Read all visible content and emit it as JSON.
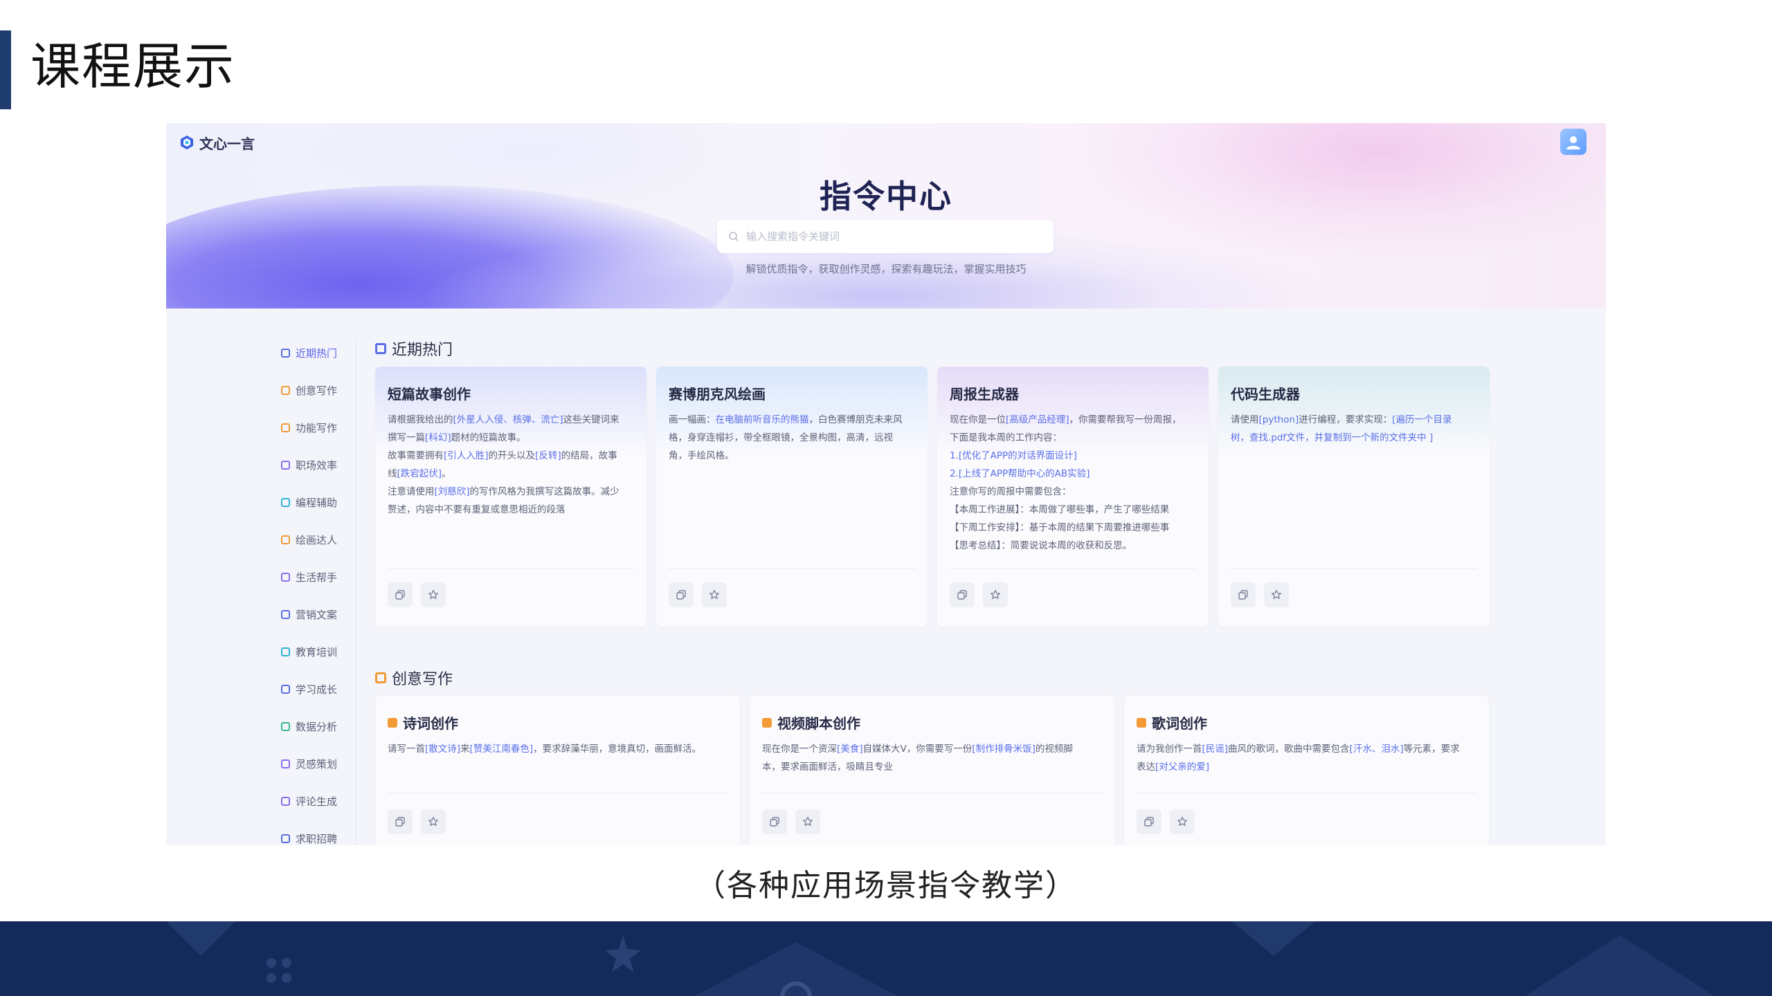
{
  "slide": {
    "title": "课程展示",
    "caption": "（各种应用场景指令教学）"
  },
  "app": {
    "logo_text": "文心一言",
    "hero_title": "指令中心",
    "search_placeholder": "输入搜索指令关键词",
    "hero_subtitle": "解锁优质指令，获取创作灵感，探索有趣玩法，掌握实用技巧"
  },
  "sidebar": {
    "items": [
      {
        "label": "近期热门",
        "color": "blue",
        "active": true
      },
      {
        "label": "创意写作",
        "color": "orange"
      },
      {
        "label": "功能写作",
        "color": "orange"
      },
      {
        "label": "职场效率",
        "color": "purple"
      },
      {
        "label": "编程辅助",
        "color": "cyan"
      },
      {
        "label": "绘画达人",
        "color": "orange"
      },
      {
        "label": "生活帮手",
        "color": "purple"
      },
      {
        "label": "营销文案",
        "color": "blue"
      },
      {
        "label": "教育培训",
        "color": "cyan"
      },
      {
        "label": "学习成长",
        "color": "blue"
      },
      {
        "label": "数据分析",
        "color": "green"
      },
      {
        "label": "灵感策划",
        "color": "purple"
      },
      {
        "label": "评论生成",
        "color": "purple"
      },
      {
        "label": "求职招聘",
        "color": "blue"
      }
    ]
  },
  "sections": {
    "hot": {
      "title": "近期热门",
      "cards": [
        {
          "title": "短篇故事创作",
          "lines": [
            [
              {
                "t": "请根据我给出的"
              },
              {
                "t": "[外星人入侵、核弹、流亡]",
                "h": true
              },
              {
                "t": "这些关键词来"
              }
            ],
            [
              {
                "t": "撰写一篇"
              },
              {
                "t": "[科幻]",
                "h": true
              },
              {
                "t": "题材的短篇故事。"
              }
            ],
            [
              {
                "t": "故事需要拥有"
              },
              {
                "t": "[引人入胜]",
                "h": true
              },
              {
                "t": "的开头以及"
              },
              {
                "t": "[反转]",
                "h": true
              },
              {
                "t": "的结局，故事"
              }
            ],
            [
              {
                "t": "线"
              },
              {
                "t": "[跌宕起伏]",
                "h": true
              },
              {
                "t": "。"
              }
            ],
            [
              {
                "t": "注意请使用"
              },
              {
                "t": "[刘慈欣]",
                "h": true
              },
              {
                "t": "的写作风格为我撰写这篇故事。减少"
              }
            ],
            [
              {
                "t": "赘述，内容中不要有重复或意思相近的段落"
              }
            ]
          ]
        },
        {
          "title": "赛博朋克风绘画",
          "lines": [
            [
              {
                "t": "画一幅画："
              },
              {
                "t": "在电脑前听音乐的熊猫",
                "h": true
              },
              {
                "t": "，白色赛博朋克未来风"
              }
            ],
            [
              {
                "t": "格，身穿连帽衫，带全框眼镜，全景构图，高清，远视"
              }
            ],
            [
              {
                "t": "角，手绘风格。"
              }
            ]
          ]
        },
        {
          "title": "周报生成器",
          "lines": [
            [
              {
                "t": "现在你是一位"
              },
              {
                "t": "[高级产品经理]",
                "h": true
              },
              {
                "t": "，你需要帮我写一份周报，"
              }
            ],
            [
              {
                "t": "下面是我本周的工作内容："
              }
            ],
            [
              {
                "t": "1.[优化了APP的对话界面设计]",
                "h": true
              }
            ],
            [
              {
                "t": "2.[上线了APP帮助中心的AB实验]",
                "h": true
              }
            ],
            [
              {
                "t": "注意你写的周报中需要包含："
              }
            ],
            [
              {
                "t": "【本周工作进展】：本周做了哪些事，产生了哪些结果"
              }
            ],
            [
              {
                "t": "【下周工作安排】：基于本周的结果下周要推进哪些事"
              }
            ],
            [
              {
                "t": "【思考总结】：简要说说本周的收获和反思。"
              }
            ]
          ]
        },
        {
          "title": "代码生成器",
          "lines": [
            [
              {
                "t": "请使用"
              },
              {
                "t": "[python]",
                "h": true
              },
              {
                "t": "进行编程，要求实现："
              },
              {
                "t": "[遍历一个目录",
                "h": true
              }
            ],
            [
              {
                "t": "树，查找.pdf文件，并复制到一个新的文件夹中 ]",
                "h": true
              }
            ]
          ]
        }
      ]
    },
    "creative": {
      "title": "创意写作",
      "cards": [
        {
          "title": "诗词创作",
          "lines": [
            [
              {
                "t": "请写一首"
              },
              {
                "t": "[散文诗]",
                "h": true
              },
              {
                "t": "来"
              },
              {
                "t": "[赞美江南春色]",
                "h": true
              },
              {
                "t": "，要求辞藻华丽，意境真切，画面鲜活。"
              }
            ]
          ]
        },
        {
          "title": "视频脚本创作",
          "lines": [
            [
              {
                "t": "现在你是一个资深"
              },
              {
                "t": "[美食]",
                "h": true
              },
              {
                "t": "自媒体大V，你需要写一份"
              },
              {
                "t": "[制作排骨米饭]",
                "h": true
              },
              {
                "t": "的视频脚"
              }
            ],
            [
              {
                "t": "本，要求画面鲜活，吸睛且专业"
              }
            ]
          ]
        },
        {
          "title": "歌词创作",
          "lines": [
            [
              {
                "t": "请为我创作一首"
              },
              {
                "t": "[民谣]",
                "h": true
              },
              {
                "t": "曲风的歌词，歌曲中需要包含"
              },
              {
                "t": "[汗水、泪水]",
                "h": true
              },
              {
                "t": "等元素，要求"
              }
            ],
            [
              {
                "t": "表达"
              },
              {
                "t": "[对父亲的爱]",
                "h": true
              }
            ]
          ]
        }
      ]
    }
  },
  "icons": {
    "copy": "copy-icon",
    "star": "star-icon",
    "search": "search-icon",
    "logo": "wenxin-logo-icon",
    "avatar": "user-avatar-icon"
  },
  "colors": {
    "accent": "#5a6fe8",
    "orange": "#f29a35",
    "footer": "#142a5a",
    "title_bar": "#1f3c6e"
  }
}
